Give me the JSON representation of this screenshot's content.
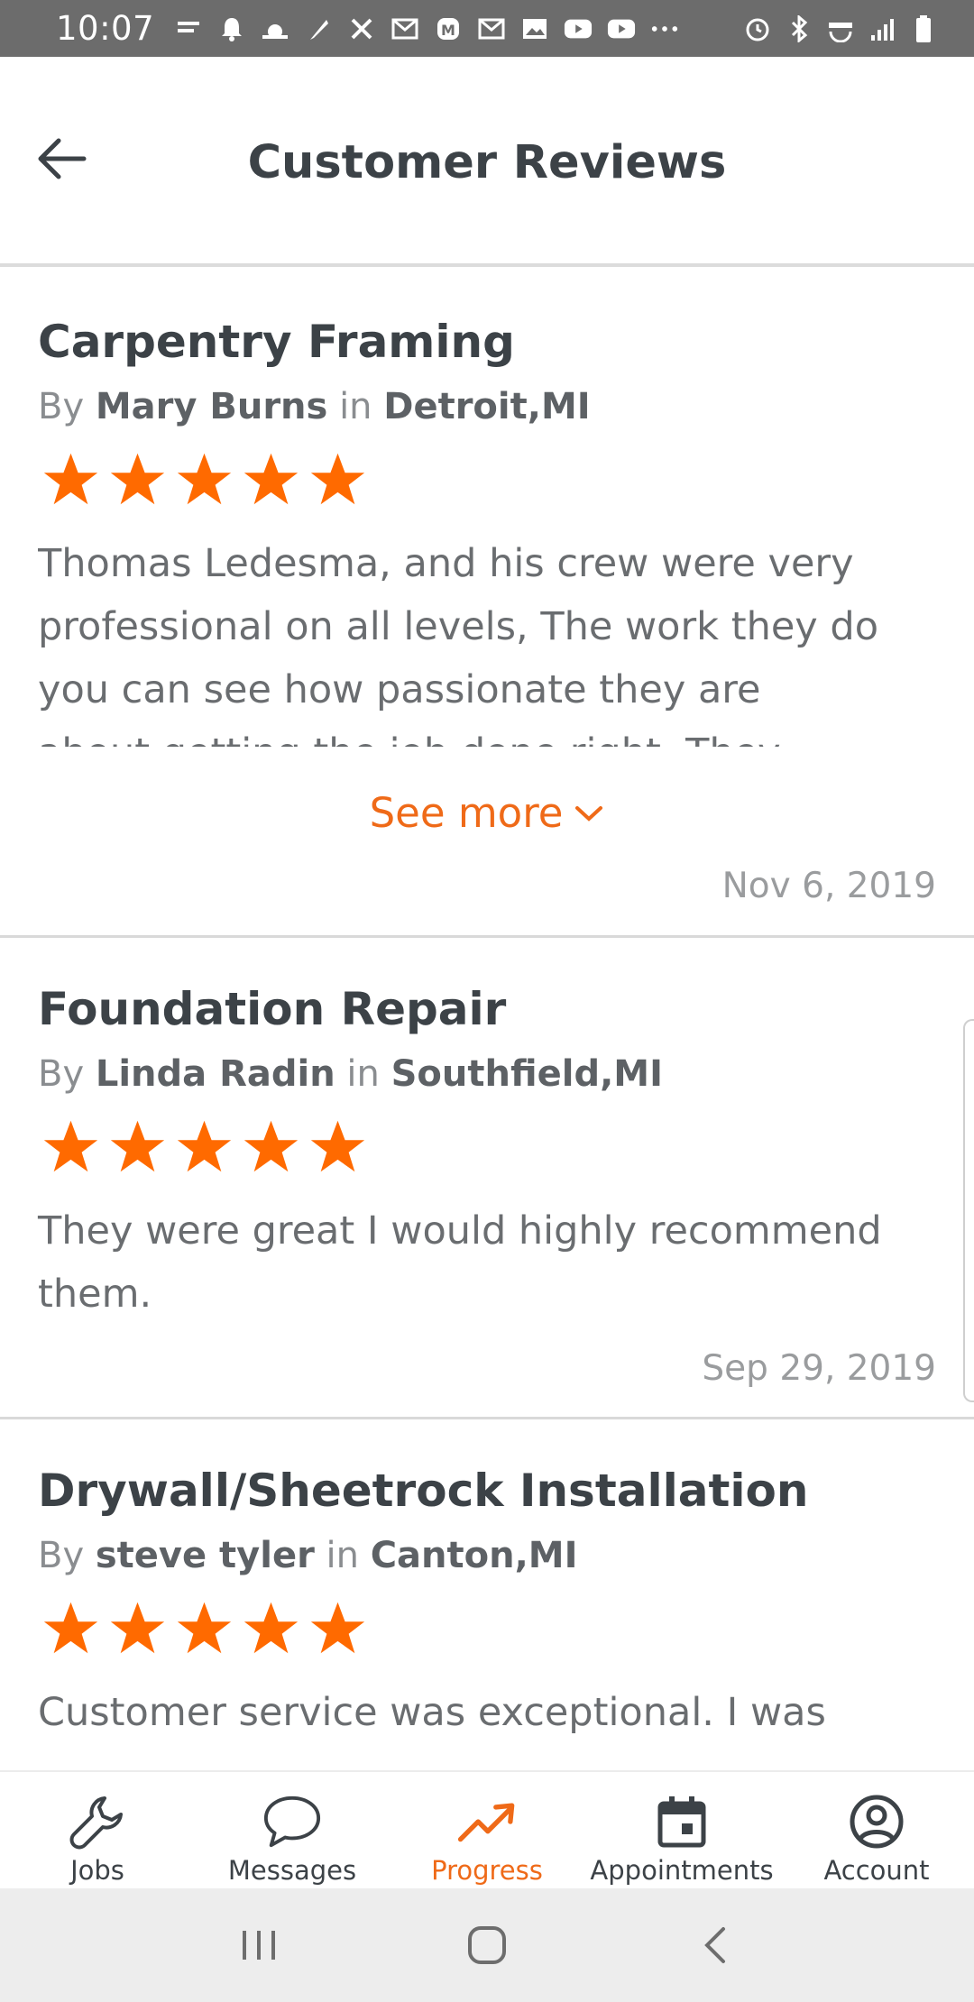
{
  "status_bar": {
    "time": "10:07"
  },
  "header": {
    "title": "Customer Reviews"
  },
  "colors": {
    "accent": "#ef6a18",
    "star": "#ff6a00",
    "text": "#3c4247"
  },
  "reviews": [
    {
      "title": "Carpentry Framing",
      "by_prefix": "By",
      "author": "Mary Burns",
      "in_word": "in",
      "location": "Detroit,MI",
      "rating": 5,
      "text": "Thomas Ledesma, and his crew were very professional on all levels, The work they do you can see how passionate they are about getting the job done right. They",
      "see_more": "See more",
      "date": "Nov 6, 2019"
    },
    {
      "title": "Foundation Repair",
      "by_prefix": "By",
      "author": "Linda Radin",
      "in_word": "in",
      "location": "Southfield,MI",
      "rating": 5,
      "text": "They were great I would highly recommend them.",
      "date": "Sep 29, 2019"
    },
    {
      "title": "Drywall/Sheetrock Installation",
      "by_prefix": "By",
      "author": "steve tyler",
      "in_word": "in",
      "location": "Canton,MI",
      "rating": 5,
      "text": "Customer service was exceptional. I was"
    }
  ],
  "bottom_nav": {
    "items": [
      {
        "label": "Jobs",
        "icon": "wrench-icon",
        "active": false
      },
      {
        "label": "Messages",
        "icon": "chat-bubble-icon",
        "active": false
      },
      {
        "label": "Progress",
        "icon": "trending-up-icon",
        "active": true
      },
      {
        "label": "Appointments",
        "icon": "calendar-icon",
        "active": false
      },
      {
        "label": "Account",
        "icon": "account-circle-icon",
        "active": false
      }
    ]
  }
}
